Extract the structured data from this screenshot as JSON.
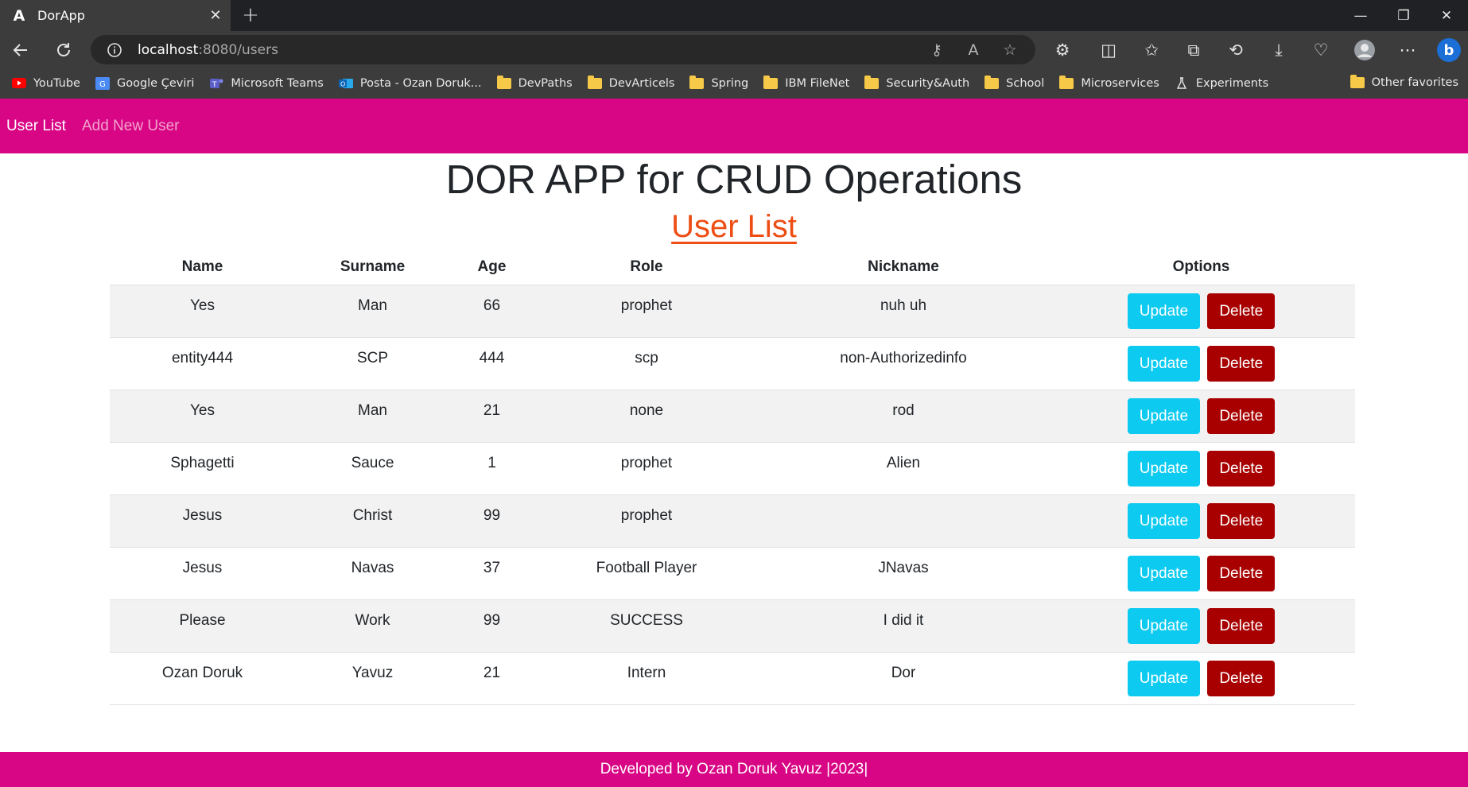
{
  "browser": {
    "tab_title": "DorApp",
    "tab_favicon_letter": "A",
    "url_host": "localhost",
    "url_path": ":8080/users",
    "bookmarks": [
      {
        "label": "YouTube",
        "icon": "youtube-icon"
      },
      {
        "label": "Google Çeviri",
        "icon": "google-translate-icon"
      },
      {
        "label": "Microsoft Teams",
        "icon": "teams-icon"
      },
      {
        "label": "Posta - Ozan Doruk...",
        "icon": "outlook-icon"
      },
      {
        "label": "DevPaths",
        "icon": "folder-icon"
      },
      {
        "label": "DevArticels",
        "icon": "folder-icon"
      },
      {
        "label": "Spring",
        "icon": "folder-icon"
      },
      {
        "label": "IBM FileNet",
        "icon": "folder-icon"
      },
      {
        "label": "Security&Auth",
        "icon": "folder-icon"
      },
      {
        "label": "School",
        "icon": "folder-icon"
      },
      {
        "label": "Microservices",
        "icon": "folder-icon"
      },
      {
        "label": "Experiments",
        "icon": "flask-icon"
      }
    ],
    "other_favorites": "Other favorites"
  },
  "nav": {
    "user_list": "User List",
    "add_new_user": "Add New User"
  },
  "page": {
    "title": "DOR APP for CRUD Operations",
    "subtitle": "User List"
  },
  "table": {
    "headers": [
      "Name",
      "Surname",
      "Age",
      "Role",
      "Nickname",
      "Options"
    ],
    "update_label": "Update",
    "delete_label": "Delete",
    "rows": [
      {
        "name": "Yes",
        "surname": "Man",
        "age": "66",
        "role": "prophet",
        "nickname": "nuh uh"
      },
      {
        "name": "entity444",
        "surname": "SCP",
        "age": "444",
        "role": "scp",
        "nickname": "non-Authorizedinfo"
      },
      {
        "name": "Yes",
        "surname": "Man",
        "age": "21",
        "role": "none",
        "nickname": "rod"
      },
      {
        "name": "Sphagetti",
        "surname": "Sauce",
        "age": "1",
        "role": "prophet",
        "nickname": "Alien"
      },
      {
        "name": "Jesus",
        "surname": "Christ",
        "age": "99",
        "role": "prophet",
        "nickname": ""
      },
      {
        "name": "Jesus",
        "surname": "Navas",
        "age": "37",
        "role": "Football Player",
        "nickname": "JNavas"
      },
      {
        "name": "Please",
        "surname": "Work",
        "age": "99",
        "role": "SUCCESS",
        "nickname": "I did it"
      },
      {
        "name": "Ozan Doruk",
        "surname": "Yavuz",
        "age": "21",
        "role": "Intern",
        "nickname": "Dor"
      }
    ]
  },
  "footer": {
    "text": "Developed by Ozan Doruk Yavuz |2023|"
  },
  "colors": {
    "brand_pink": "#d80685",
    "subtitle_orange": "#ee4d14",
    "update_cyan": "#0dcaf0",
    "delete_red": "#a80000"
  }
}
